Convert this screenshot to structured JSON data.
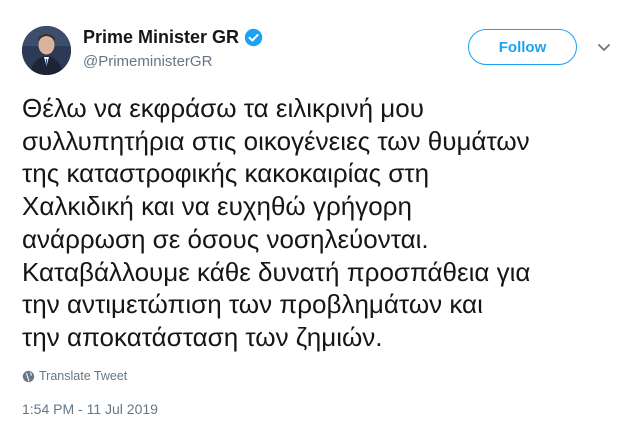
{
  "tweet": {
    "author": {
      "display_name": "Prime Minister GR",
      "handle": "@PrimeministerGR",
      "verified": true
    },
    "follow_label": "Follow",
    "text": "Θέλω να εκφράσω τα ειλικρινή μου\nσυλλυπητήρια στις οικογένειες των θυμάτων\nτης καταστροφικής κακοκαιρίας στη\nΧαλκιδική και να ευχηθώ γρήγορη\nανάρρωση σε όσους νοσηλεύονται.\nΚαταβάλλουμε κάθε δυνατή προσπάθεια για\nτην αντιμετώπιση των προβλημάτων και\nτην αποκατάσταση των ζημιών.",
    "translate_label": "Translate Tweet",
    "timestamp": "1:54 PM - 11 Jul 2019"
  },
  "colors": {
    "accent": "#1da1f2",
    "text": "#14171a",
    "secondary": "#657786"
  },
  "icons": {
    "verified": "verified-badge-icon",
    "caret": "chevron-down-icon",
    "translate": "globe-icon"
  }
}
